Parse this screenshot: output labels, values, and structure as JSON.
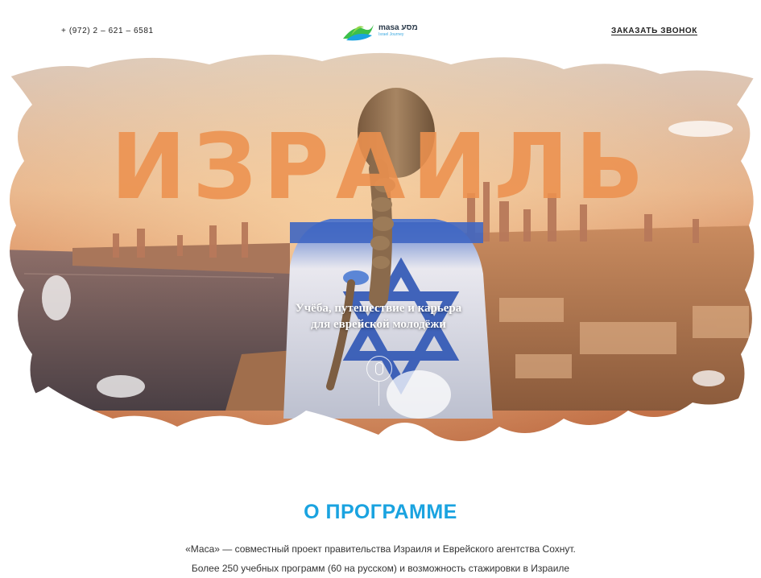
{
  "header": {
    "phone": "+ (972) 2 – 621 – 6581",
    "logo": {
      "brand": "masa",
      "brand_hebrew": "מסע",
      "sub": "Israel Journey"
    },
    "callback_label": "ЗАКАЗАТЬ ЗВОНОК"
  },
  "hero": {
    "title": "ИЗРАИЛЬ",
    "subtitle_line1": "Учёба, путешествие и карьера",
    "subtitle_line2": "для еврейской молодёжи",
    "scroll_icon": "mouse-scroll-icon"
  },
  "about": {
    "title": "О ПРОГРАММЕ",
    "line1": "«Маса» — совместный проект правительства Израиля и Еврейского агентства Сохнут.",
    "line2": "Более 250 учебных программ (60 на русском) и возможность стажировки в Израиле"
  },
  "colors": {
    "accent_blue": "#1aa3e0",
    "title_orange": "#ec914e",
    "logo_green": "#3cbf4a"
  }
}
